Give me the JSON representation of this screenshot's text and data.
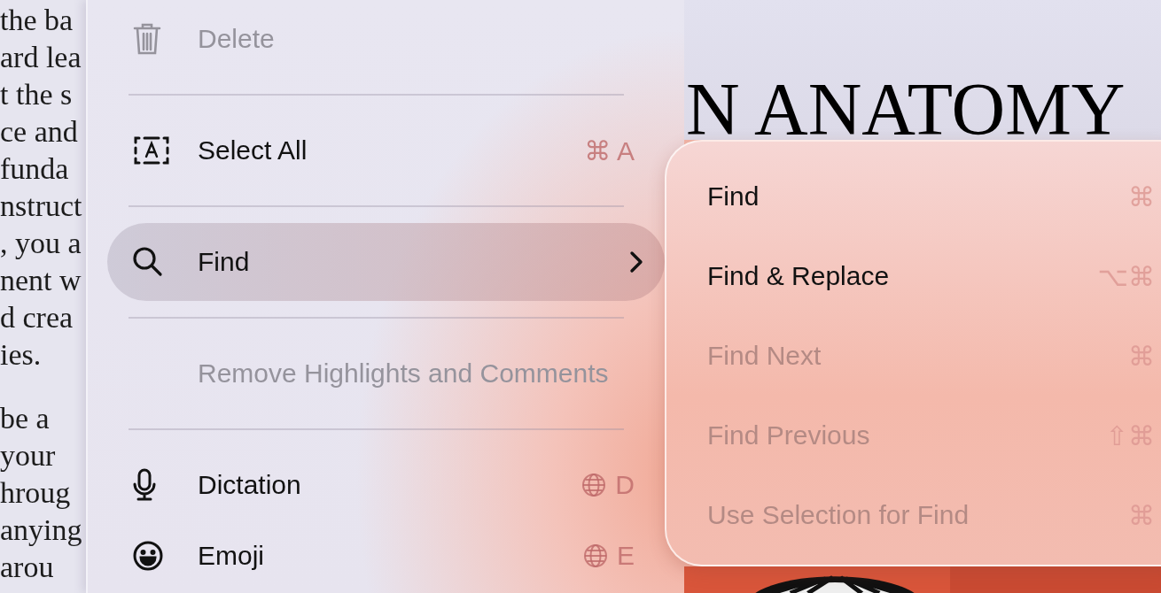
{
  "document": {
    "paragraphs": [
      [
        "the ba",
        "ard lea",
        "t the s",
        "ce and",
        "funda",
        "nstruct",
        ", you a",
        "nent w",
        "d crea",
        "ies."
      ],
      [
        "be a",
        "your",
        "hroug",
        "anying",
        "arou"
      ]
    ]
  },
  "cover": {
    "title": "N ANATOMY",
    "kind": "picture"
  },
  "menu": {
    "groups": [
      [
        {
          "label": "Delete",
          "disabled": true,
          "selected": false,
          "has_submenu": false
        }
      ],
      [
        {
          "label": "Select All",
          "shortcut": "⌘ A",
          "disabled": false,
          "selected": false,
          "has_submenu": false
        }
      ],
      [
        {
          "label": "Find",
          "disabled": false,
          "selected": true,
          "has_submenu": true
        }
      ],
      [
        {
          "label": "Remove Highlights and Comments",
          "disabled": true,
          "selected": false,
          "has_submenu": false
        }
      ],
      [
        {
          "label": "Dictation",
          "shortcut": "D",
          "globe": true,
          "disabled": false,
          "selected": false,
          "has_submenu": false
        },
        {
          "label": "Emoji",
          "shortcut": "E",
          "globe": true,
          "disabled": false,
          "selected": false,
          "has_submenu": false
        }
      ]
    ]
  },
  "submenu": {
    "items": [
      {
        "label": "Find",
        "shortcut": "⌘",
        "disabled": false
      },
      {
        "label": "Find & Replace",
        "shortcut": "⌥⌘",
        "disabled": false
      },
      {
        "label": "Find Next",
        "shortcut": "⌘",
        "disabled": true
      },
      {
        "label": "Find Previous",
        "shortcut": "⇧⌘",
        "disabled": true
      },
      {
        "label": "Use Selection for Find",
        "shortcut": "⌘",
        "disabled": true
      }
    ]
  }
}
